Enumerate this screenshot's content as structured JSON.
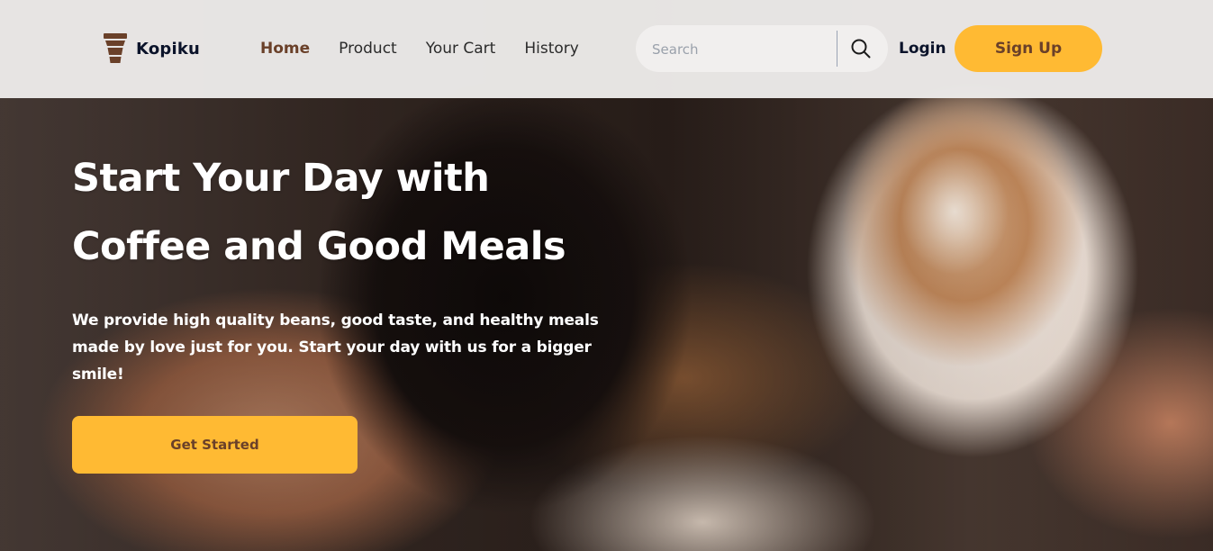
{
  "brand": {
    "name": "Kopiku"
  },
  "nav": {
    "items": [
      {
        "label": "Home",
        "active": true
      },
      {
        "label": "Product",
        "active": false
      },
      {
        "label": "Your Cart",
        "active": false
      },
      {
        "label": "History",
        "active": false
      }
    ]
  },
  "search": {
    "placeholder": "Search",
    "value": ""
  },
  "auth": {
    "login_label": "Login",
    "signup_label": "Sign Up"
  },
  "hero": {
    "title_line1": "Start Your Day with",
    "title_line2": "Coffee and Good Meals",
    "description": "We provide high quality beans, good taste, and healthy meals made by love just for you. Start your day with us for a bigger smile!",
    "cta_label": "Get Started"
  },
  "colors": {
    "accent": "#ffba33",
    "brand_brown": "#6a4029",
    "dark_text": "#0b132a",
    "header_bg": "#eceae9"
  },
  "icons": {
    "logo": "coffee-cup-icon",
    "search": "search-icon"
  }
}
